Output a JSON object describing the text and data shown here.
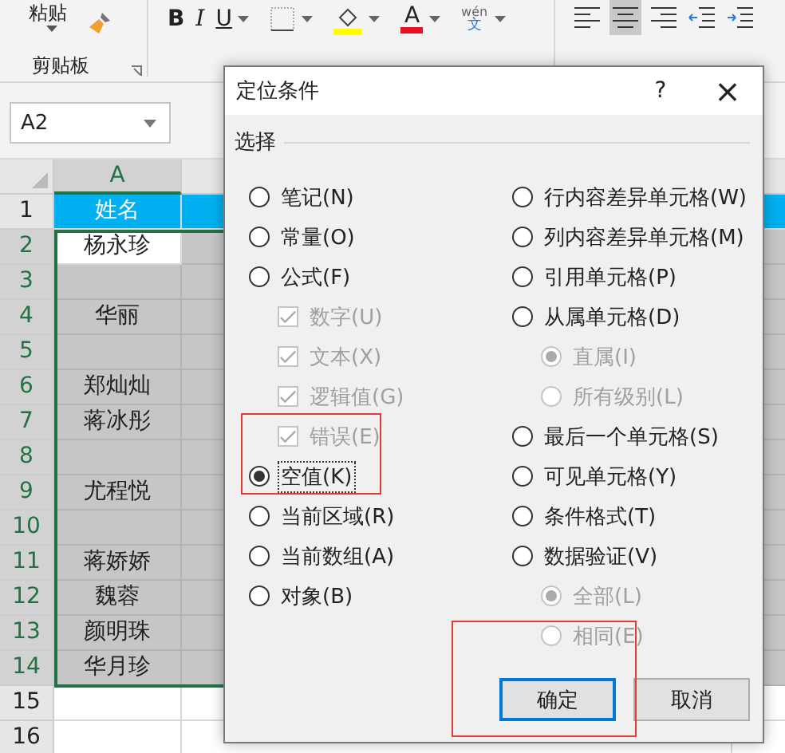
{
  "ribbon": {
    "clipboard": {
      "paste": "粘贴",
      "label": "剪贴板"
    },
    "font_buttons": [
      {
        "kind": "bold",
        "label": "B"
      },
      {
        "kind": "italic",
        "label": "I"
      },
      {
        "kind": "underline",
        "label": "U"
      },
      {
        "kind": "border"
      },
      {
        "kind": "fill"
      },
      {
        "kind": "font_color",
        "label": "A"
      },
      {
        "kind": "phonetic",
        "label": "wén",
        "sub": "文"
      }
    ],
    "align_buttons": [
      {
        "kind": "left",
        "selected": false
      },
      {
        "kind": "center",
        "selected": true
      },
      {
        "kind": "right",
        "selected": false
      },
      {
        "kind": "outdent",
        "selected": false
      },
      {
        "kind": "indent",
        "selected": false
      }
    ]
  },
  "name_box": {
    "value": "A2"
  },
  "sheet": {
    "columns": [
      {
        "label": "A",
        "selected": true
      }
    ],
    "rows": [
      {
        "number": "1",
        "name": "姓名",
        "kind": "header",
        "selected": false,
        "active": false
      },
      {
        "number": "2",
        "name": "杨永珍",
        "kind": "data",
        "selected": true,
        "active": true
      },
      {
        "number": "3",
        "kind": "data",
        "selected": true,
        "active": false
      },
      {
        "number": "4",
        "name": "华丽",
        "kind": "data",
        "selected": true,
        "active": false
      },
      {
        "number": "5",
        "kind": "data",
        "selected": true,
        "active": false
      },
      {
        "number": "6",
        "name": "郑灿灿",
        "kind": "data",
        "selected": true,
        "active": false
      },
      {
        "number": "7",
        "name": "蒋冰彤",
        "kind": "data",
        "selected": true,
        "active": false
      },
      {
        "number": "8",
        "kind": "data",
        "selected": true,
        "active": false
      },
      {
        "number": "9",
        "name": "尤程悦",
        "kind": "data",
        "selected": true,
        "active": false
      },
      {
        "number": "10",
        "kind": "data",
        "selected": true,
        "active": false
      },
      {
        "number": "11",
        "name": "蒋娇娇",
        "kind": "data",
        "selected": true,
        "active": false
      },
      {
        "number": "12",
        "name": "魏蓉",
        "kind": "data",
        "selected": true,
        "active": false
      },
      {
        "number": "13",
        "name": "颜明珠",
        "kind": "data",
        "selected": true,
        "active": false
      },
      {
        "number": "14",
        "name": "华月珍",
        "kind": "data",
        "selected": true,
        "active": false
      },
      {
        "number": "15",
        "kind": "data",
        "selected": false,
        "active": false
      },
      {
        "number": "16",
        "kind": "data",
        "selected": false,
        "active": false
      }
    ]
  },
  "dialog": {
    "title": "定位条件",
    "help": "?",
    "close": "×",
    "group": "选择",
    "left": [
      {
        "label": "笔记(N)",
        "kind": "radio",
        "selected": false,
        "disabled": false,
        "focused": false
      },
      {
        "label": "常量(O)",
        "kind": "radio",
        "selected": false,
        "disabled": false,
        "focused": false
      },
      {
        "label": "公式(F)",
        "kind": "radio",
        "selected": false,
        "disabled": false,
        "focused": false,
        "children": [
          {
            "label": "数字(U)",
            "kind": "checkbox",
            "checked": true,
            "disabled": true
          },
          {
            "label": "文本(X)",
            "kind": "checkbox",
            "checked": true,
            "disabled": true
          },
          {
            "label": "逻辑值(G)",
            "kind": "checkbox",
            "checked": true,
            "disabled": true
          },
          {
            "label": "错误(E)",
            "kind": "checkbox",
            "checked": true,
            "disabled": true
          }
        ]
      },
      {
        "label": "空值(K)",
        "kind": "radio",
        "selected": true,
        "disabled": false,
        "focused": true
      },
      {
        "label": "当前区域(R)",
        "kind": "radio",
        "selected": false,
        "disabled": false,
        "focused": false
      },
      {
        "label": "当前数组(A)",
        "kind": "radio",
        "selected": false,
        "disabled": false,
        "focused": false
      },
      {
        "label": "对象(B)",
        "kind": "radio",
        "selected": false,
        "disabled": false,
        "focused": false
      }
    ],
    "right": [
      {
        "label": "行内容差异单元格(W)",
        "kind": "radio",
        "selected": false,
        "disabled": false,
        "focused": false
      },
      {
        "label": "列内容差异单元格(M)",
        "kind": "radio",
        "selected": false,
        "disabled": false,
        "focused": false
      },
      {
        "label": "引用单元格(P)",
        "kind": "radio",
        "selected": false,
        "disabled": false,
        "focused": false
      },
      {
        "label": "从属单元格(D)",
        "kind": "radio",
        "selected": false,
        "disabled": false,
        "focused": false,
        "children": [
          {
            "label": "直属(I)",
            "kind": "radio",
            "selected": true,
            "disabled": true
          },
          {
            "label": "所有级别(L)",
            "kind": "radio",
            "selected": false,
            "disabled": true
          }
        ]
      },
      {
        "label": "最后一个单元格(S)",
        "kind": "radio",
        "selected": false,
        "disabled": false,
        "focused": false
      },
      {
        "label": "可见单元格(Y)",
        "kind": "radio",
        "selected": false,
        "disabled": false,
        "focused": false
      },
      {
        "label": "条件格式(T)",
        "kind": "radio",
        "selected": false,
        "disabled": false,
        "focused": false
      },
      {
        "label": "数据验证(V)",
        "kind": "radio",
        "selected": false,
        "disabled": false,
        "focused": false,
        "children": [
          {
            "label": "全部(L)",
            "kind": "radio",
            "selected": true,
            "disabled": true
          },
          {
            "label": "相同(E)",
            "kind": "radio",
            "selected": false,
            "disabled": true
          }
        ]
      }
    ],
    "buttons": [
      {
        "label": "确定",
        "default": true
      },
      {
        "label": "取消",
        "default": false
      }
    ]
  },
  "annotations": {
    "options_frame": true,
    "button_frame": true
  }
}
